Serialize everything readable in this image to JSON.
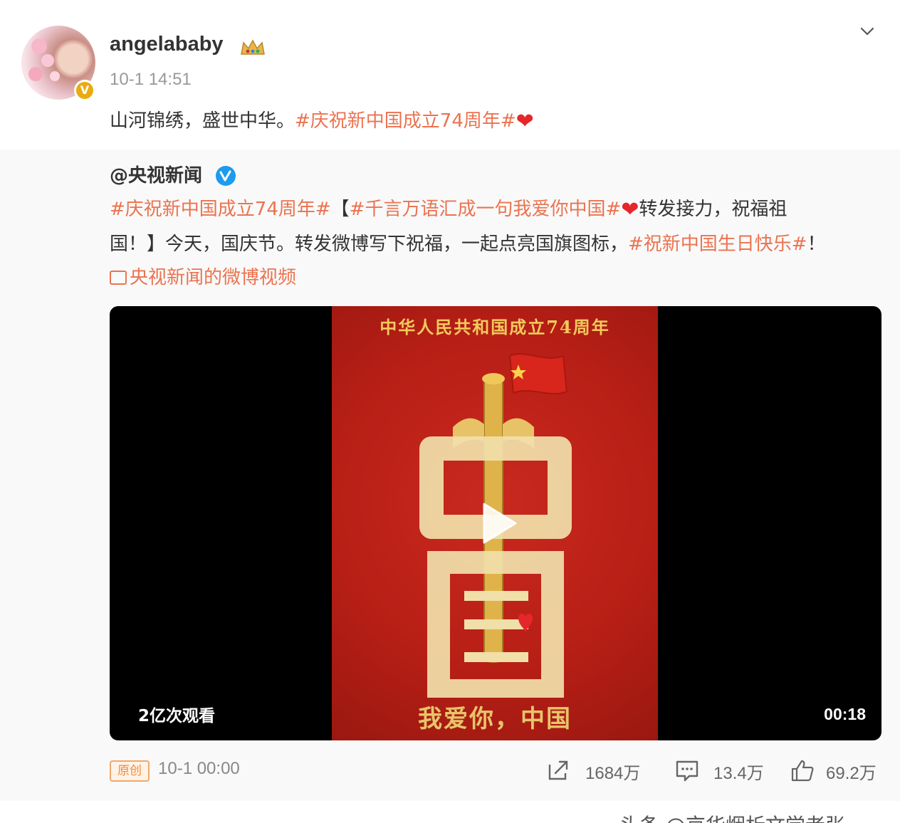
{
  "post": {
    "username": "angelababy",
    "time": "10-1 14:51",
    "text_plain": "山河锦绣，盛世中华。",
    "text_topic": "#庆祝新中国成立74周年#"
  },
  "repost": {
    "author": "@央视新闻",
    "line1_topic1": "#庆祝新中国成立74周年#",
    "line1_bracket": "【",
    "line1_topic2": "#千言万语汇成一句我爱你中国#",
    "line1_rest": "转发接力，祝福祖",
    "line2_text": "国！】今天，国庆节。转发微博写下祝福，一起点亮国旗图标，",
    "line2_topic": "#祝新中国生日快乐#",
    "line2_end": "！",
    "video_link": "央视新闻的微博视频"
  },
  "video": {
    "poster_title": "中华人民共和国成立74周年",
    "poster_slogan": "我爱你，中国",
    "poster_big_chars": "中国",
    "views": "2亿次观看",
    "duration": "00:18"
  },
  "footer": {
    "original_label": "原创",
    "time": "10-1 00:00",
    "reposts": "1684万",
    "comments": "13.4万",
    "likes": "69.2万"
  },
  "watermark": "头条 @京华烟析文学老张",
  "colors": {
    "topic": "#eb7350",
    "heart": "#e5262b",
    "verified_orange": "#e8ac10",
    "verified_blue": "#1d9bf0",
    "poster_red": "#b81f16",
    "poster_gold": "#f4c95c"
  }
}
